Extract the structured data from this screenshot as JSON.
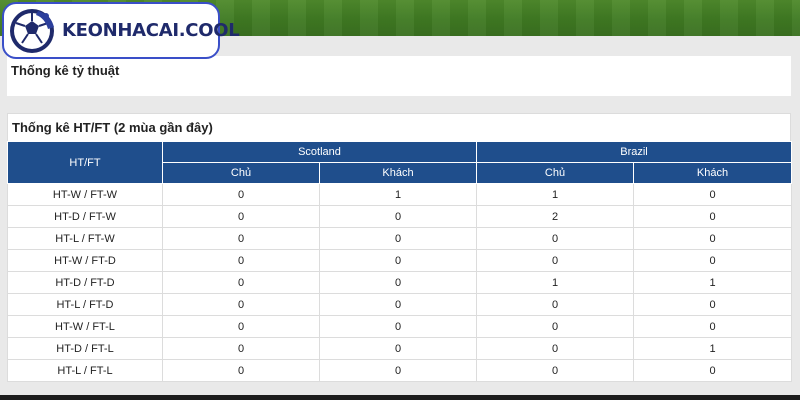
{
  "brand": {
    "logo_text": "KEONHACAI.COOL"
  },
  "ratio_panel": {
    "title": "Thống kê tỷ thuật"
  },
  "htft_panel": {
    "title": "Thống kê HT/FT (2 mùa gần đây)",
    "first_column_header": "HT/FT",
    "teams": [
      "Scotland",
      "Brazil"
    ],
    "sub_headers": [
      "Chủ",
      "Khách",
      "Chủ",
      "Khách"
    ],
    "rows": [
      {
        "label": "HT-W / FT-W",
        "values": [
          "0",
          "1",
          "1",
          "0"
        ]
      },
      {
        "label": "HT-D / FT-W",
        "values": [
          "0",
          "0",
          "2",
          "0"
        ]
      },
      {
        "label": "HT-L / FT-W",
        "values": [
          "0",
          "0",
          "0",
          "0"
        ]
      },
      {
        "label": "HT-W / FT-D",
        "values": [
          "0",
          "0",
          "0",
          "0"
        ]
      },
      {
        "label": "HT-D / FT-D",
        "values": [
          "0",
          "0",
          "1",
          "1"
        ]
      },
      {
        "label": "HT-L / FT-D",
        "values": [
          "0",
          "0",
          "0",
          "0"
        ]
      },
      {
        "label": "HT-W / FT-L",
        "values": [
          "0",
          "0",
          "0",
          "0"
        ]
      },
      {
        "label": "HT-D / FT-L",
        "values": [
          "0",
          "0",
          "0",
          "1"
        ]
      },
      {
        "label": "HT-L / FT-L",
        "values": [
          "0",
          "0",
          "0",
          "0"
        ]
      }
    ]
  },
  "colors": {
    "header_blue": "#1f4e8c",
    "logo_border": "#3a4fc8",
    "grass": "#3f7a22"
  },
  "icons": {
    "logo": "soccer-player-ball-icon"
  }
}
